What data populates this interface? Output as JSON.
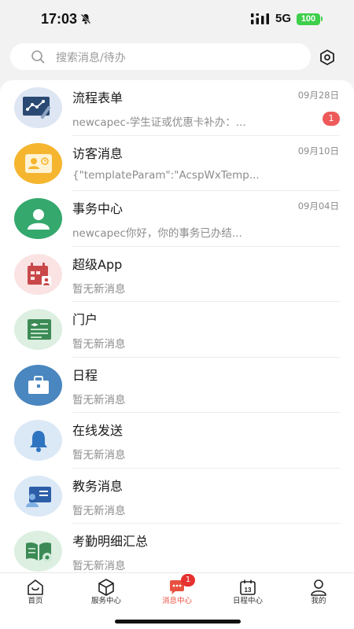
{
  "status_bar": {
    "time": "17:03",
    "network": "5G",
    "battery": "100"
  },
  "search": {
    "placeholder": "搜索消息/待办"
  },
  "messages": [
    {
      "title": "流程表单",
      "date": "09月28日",
      "preview": "newcapec-学生证或优惠卡补办：...",
      "badge": "1",
      "icon": "workflow-form-icon"
    },
    {
      "title": "访客消息",
      "date": "09月10日",
      "preview": "{\"templateParam\":\"AcspWxTemp...",
      "badge": "",
      "icon": "visitor-card-icon"
    },
    {
      "title": "事务中心",
      "date": "09月04日",
      "preview": "newcapec你好，你的事务已办结...",
      "badge": "",
      "icon": "user-icon"
    },
    {
      "title": "超级App",
      "date": "",
      "preview": "暂无新消息",
      "badge": "",
      "icon": "calendar-user-icon"
    },
    {
      "title": "门户",
      "date": "",
      "preview": "暂无新消息",
      "badge": "",
      "icon": "portal-board-icon"
    },
    {
      "title": "日程",
      "date": "",
      "preview": "暂无新消息",
      "badge": "",
      "icon": "briefcase-icon"
    },
    {
      "title": "在线发送",
      "date": "",
      "preview": "暂无新消息",
      "badge": "",
      "icon": "bell-icon"
    },
    {
      "title": "教务消息",
      "date": "",
      "preview": "暂无新消息",
      "badge": "",
      "icon": "teaching-icon"
    },
    {
      "title": "考勤明细汇总",
      "date": "",
      "preview": "暂无新消息",
      "badge": "",
      "icon": "attendance-book-icon"
    }
  ],
  "tabs": [
    {
      "label": "首页",
      "icon": "home-icon",
      "active": false
    },
    {
      "label": "服务中心",
      "icon": "cube-icon",
      "active": false
    },
    {
      "label": "消息中心",
      "icon": "chat-icon",
      "active": true,
      "badge": "1"
    },
    {
      "label": "日程中心",
      "icon": "calendar-icon",
      "active": false
    },
    {
      "label": "我的",
      "icon": "profile-icon",
      "active": false
    }
  ],
  "colors": {
    "accent": "#e8503f",
    "badge": "#ee5a5a",
    "battery": "#3ecf4b"
  }
}
